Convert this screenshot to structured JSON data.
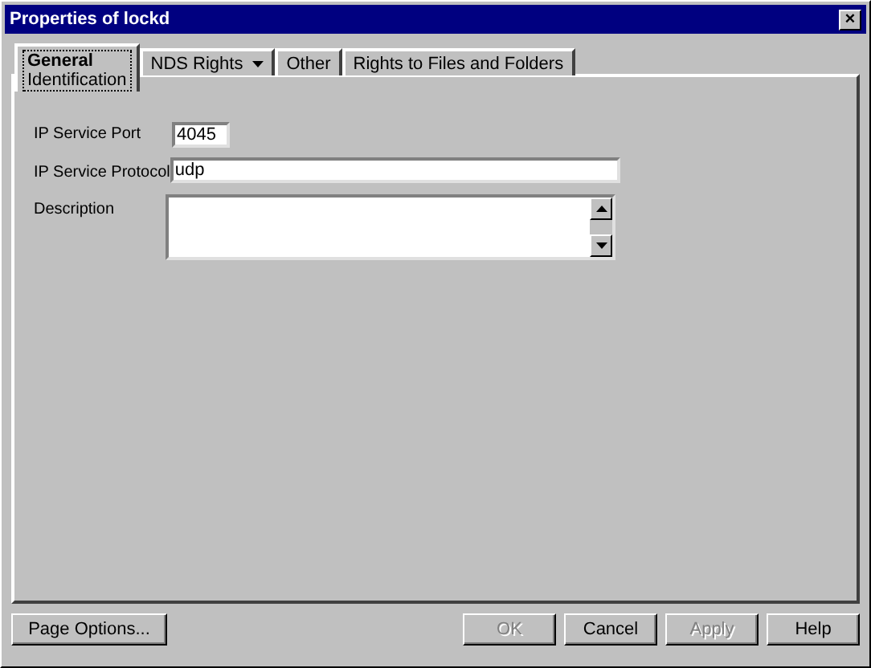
{
  "window": {
    "title": "Properties of lockd",
    "close": "×"
  },
  "tabs": [
    {
      "label": "General",
      "sublabel": "Identification",
      "selected": true,
      "dropdown": false
    },
    {
      "label": "NDS Rights",
      "selected": false,
      "dropdown": true
    },
    {
      "label": "Other",
      "selected": false,
      "dropdown": false
    },
    {
      "label": "Rights to Files and Folders",
      "selected": false,
      "dropdown": false
    }
  ],
  "fields": [
    {
      "label": "IP Service Port",
      "kind": "short",
      "value": "4045"
    },
    {
      "label": "IP Service Protocol",
      "kind": "text",
      "value": "udp"
    },
    {
      "label": "Description",
      "kind": "multiline"
    }
  ],
  "buttons": [
    {
      "label": "Page Options...",
      "disabled": false,
      "kind": "left"
    },
    {
      "label": "OK",
      "disabled": true,
      "kind": "right"
    },
    {
      "label": "Cancel",
      "disabled": false,
      "kind": "right"
    },
    {
      "label": "Apply",
      "disabled": true,
      "kind": "right"
    },
    {
      "label": "Help",
      "disabled": false,
      "kind": "right"
    }
  ]
}
